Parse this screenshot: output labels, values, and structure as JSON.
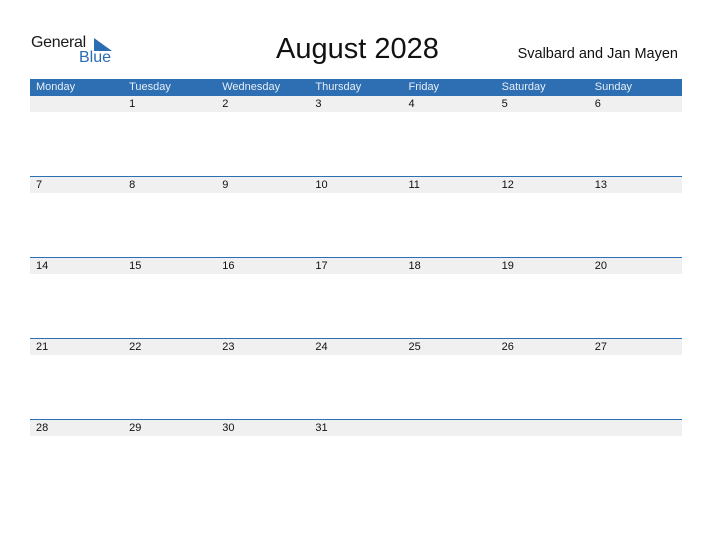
{
  "logo": {
    "general": "General",
    "blue": "Blue",
    "accent_color": "#2a6db3"
  },
  "title": "August 2028",
  "region": "Svalbard and Jan Mayen",
  "header_color": "#2d6fb2",
  "weekdays": [
    "Monday",
    "Tuesday",
    "Wednesday",
    "Thursday",
    "Friday",
    "Saturday",
    "Sunday"
  ],
  "weeks": [
    [
      "",
      "1",
      "2",
      "3",
      "4",
      "5",
      "6"
    ],
    [
      "7",
      "8",
      "9",
      "10",
      "11",
      "12",
      "13"
    ],
    [
      "14",
      "15",
      "16",
      "17",
      "18",
      "19",
      "20"
    ],
    [
      "21",
      "22",
      "23",
      "24",
      "25",
      "26",
      "27"
    ],
    [
      "28",
      "29",
      "30",
      "31",
      "",
      "",
      ""
    ]
  ]
}
